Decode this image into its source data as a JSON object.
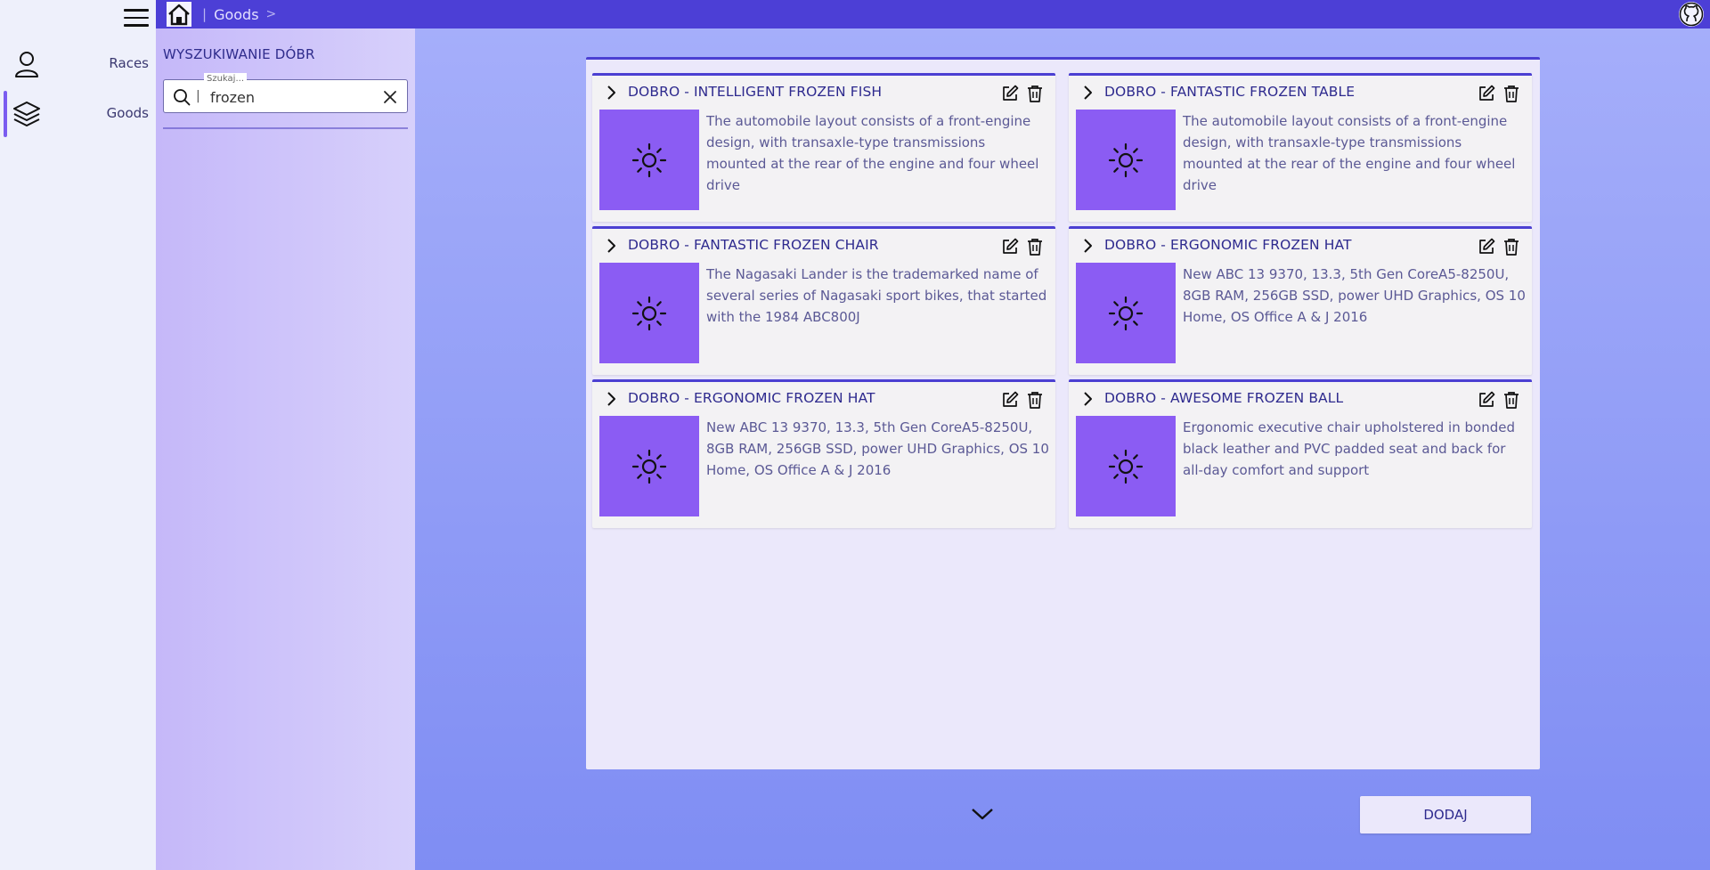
{
  "breadcrumb": {
    "current": "Goods",
    "separator": ">"
  },
  "nav": {
    "items": [
      {
        "label": "Races",
        "icon": "user-icon"
      },
      {
        "label": "Goods",
        "icon": "layers-icon",
        "active": true
      }
    ]
  },
  "search_panel": {
    "title": "WYSZUKIWANIE DÓBR",
    "legend": "Szukaj...",
    "value": "frozen"
  },
  "cards": [
    {
      "title": "DOBRO - INTELLIGENT FROZEN FISH",
      "description": "The automobile layout consists of a front-engine design, with transaxle-type transmissions mounted at the rear of the engine and four wheel drive"
    },
    {
      "title": "DOBRO - FANTASTIC FROZEN TABLE",
      "description": "The automobile layout consists of a front-engine design, with transaxle-type transmissions mounted at the rear of the engine and four wheel drive"
    },
    {
      "title": "DOBRO - FANTASTIC FROZEN CHAIR",
      "description": "The Nagasaki Lander is the trademarked name of several series of Nagasaki sport bikes, that started with the 1984 ABC800J"
    },
    {
      "title": "DOBRO - ERGONOMIC FROZEN HAT",
      "description": "New ABC 13 9370, 13.3, 5th Gen CoreA5-8250U, 8GB RAM, 256GB SSD, power UHD Graphics, OS 10 Home, OS Office A & J 2016"
    },
    {
      "title": "DOBRO - ERGONOMIC FROZEN HAT",
      "description": "New ABC 13 9370, 13.3, 5th Gen CoreA5-8250U, 8GB RAM, 256GB SSD, power UHD Graphics, OS 10 Home, OS Office A & J 2016"
    },
    {
      "title": "DOBRO - AWESOME FROZEN BALL",
      "description": "Ergonomic executive chair upholstered in bonded black leather and PVC padded seat and back for all-day comfort and support"
    }
  ],
  "actions": {
    "add_label": "DODAJ"
  },
  "colors": {
    "accent": "#4c3fd6",
    "thumb": "#8b5cf3"
  }
}
